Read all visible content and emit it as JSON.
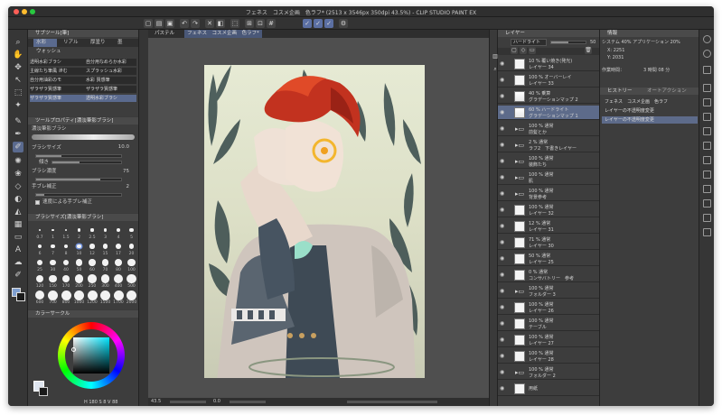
{
  "window": {
    "title": "フェネス　コスメ企画　色ラフ* (2513 x 3546px 350dpi 43.5%)  - CLIP STUDIO PAINT EX"
  },
  "colors": {
    "accent": "#5a6a8e",
    "selected_layer": "#5d6b8a",
    "traffic_close": "#fe5f57",
    "traffic_min": "#febc2e",
    "traffic_max": "#28c840"
  },
  "sub_tool": {
    "header": "サブツール[筆]",
    "tabs": [
      "水彩",
      "リアル",
      "厚塗り",
      "墨"
    ],
    "extra_tab": "ウォッシュ",
    "brushes": [
      "透明水彩ブラシ",
      "主線たち筆風 滲む",
      "自分用油彩のモ",
      "ザラザラ質感筆",
      "ザラザラ質感筆"
    ],
    "brushes_right": [
      "自分用なめらか水彩",
      "スプラッシュ水彩",
      "水彩 質感筆",
      "ザラザラ質感筆",
      "透明水彩ブラシ"
    ]
  },
  "tool_property": {
    "header": "ツールプロパティ[濃淡筆影ブラシ]",
    "tool_name": "濃淡筆影ブラシ",
    "brush_size_label": "ブラシサイズ",
    "brush_size_value": "10.0",
    "brush_size_fill": 0.3,
    "tilt_label": "傾き",
    "density_label": "ブラシ濃度",
    "density_value": "75",
    "density_fill": 0.75,
    "stabilization_label": "手ブレ補正",
    "stabilization_value": "2",
    "speed_label": "速度による手ブレ補正"
  },
  "brush_size_panel": {
    "header": "ブラシサイズ[濃淡筆影ブラシ]",
    "sizes": [
      "0.7",
      "1",
      "1.5",
      "2",
      "2.5",
      "3",
      "4",
      "5",
      "6",
      "7",
      "8",
      "10",
      "12",
      "15",
      "17",
      "20",
      "25",
      "30",
      "40",
      "50",
      "60",
      "70",
      "80",
      "100",
      "120",
      "150",
      "170",
      "200",
      "250",
      "300",
      "400",
      "500",
      "600",
      "700",
      "800",
      "1000",
      "1200",
      "1500",
      "1700",
      "2000"
    ]
  },
  "color_panel": {
    "header": "カラーサークル",
    "h_value": "180",
    "s_value": "8",
    "v_value": "88"
  },
  "canvas": {
    "tab_palette": "パステル",
    "doc_tab": "フェネス　コスメ企画　色ラフ*",
    "zoom": "43.5",
    "angle": "0.0"
  },
  "layer_panel": {
    "header": "レイヤー",
    "blend_mode": "ハードライト",
    "opacity": "50",
    "layers": [
      {
        "mode": "10 % 覆い焼き(発光)",
        "name": "レイヤー 34",
        "type": "layer"
      },
      {
        "mode": "100 % オーバーレイ",
        "name": "レイヤー 33",
        "type": "layer"
      },
      {
        "mode": "40 % 乗算",
        "name": "グラデーションマップ 2",
        "type": "gradient"
      },
      {
        "mode": "60 % ハードライト",
        "name": "グラデーションマップ 1",
        "type": "gradient",
        "selected": true
      },
      {
        "mode": "100 % 通常",
        "name": "前髪とか",
        "type": "folder"
      },
      {
        "mode": "2 % 通常",
        "name": "ラフ2　下書きレイヤー",
        "type": "folder"
      },
      {
        "mode": "100 % 通常",
        "name": "装飾たち",
        "type": "folder"
      },
      {
        "mode": "100 % 通常",
        "name": "肌",
        "type": "folder"
      },
      {
        "mode": "100 % 通常",
        "name": "背景参考",
        "type": "folder"
      },
      {
        "mode": "100 % 通常",
        "name": "レイヤー 32",
        "type": "layer"
      },
      {
        "mode": "12 % 通常",
        "name": "レイヤー 31",
        "type": "layer"
      },
      {
        "mode": "71 % 通常",
        "name": "レイヤー 30",
        "type": "layer"
      },
      {
        "mode": "50 % 通常",
        "name": "レイヤー 25",
        "type": "layer"
      },
      {
        "mode": "0 % 通常",
        "name": "コンサバトリー　参考",
        "type": "layer"
      },
      {
        "mode": "100 % 通常",
        "name": "フォルダー 3",
        "type": "folder"
      },
      {
        "mode": "100 % 通常",
        "name": "レイヤー 26",
        "type": "layer"
      },
      {
        "mode": "100 % 通常",
        "name": "テーブル",
        "type": "layer"
      },
      {
        "mode": "100 % 通常",
        "name": "レイヤー 27",
        "type": "layer"
      },
      {
        "mode": "100 % 通常",
        "name": "レイヤー 28",
        "type": "layer"
      },
      {
        "mode": "100 % 通常",
        "name": "フォルダー 2",
        "type": "folder"
      },
      {
        "mode": "",
        "name": "用紙",
        "type": "paper"
      }
    ]
  },
  "info_panel": {
    "header": "情報",
    "system_line": "システム 40%  アプリケーション 20%",
    "x_label": "X: 2251",
    "y_label": "Y: 2031",
    "work_time_label": "作業時間：",
    "work_time_value": "3 時間 08 分"
  },
  "history_panel": {
    "header": "ヒストリー",
    "tab2": "オートアクション",
    "items": [
      {
        "text": "フェネス　コスメ企画　色ラフ",
        "selected": false
      },
      {
        "text": "レイヤーの不透明度変更",
        "selected": false
      },
      {
        "text": "レイヤーの不透明度変更",
        "selected": true
      }
    ]
  }
}
